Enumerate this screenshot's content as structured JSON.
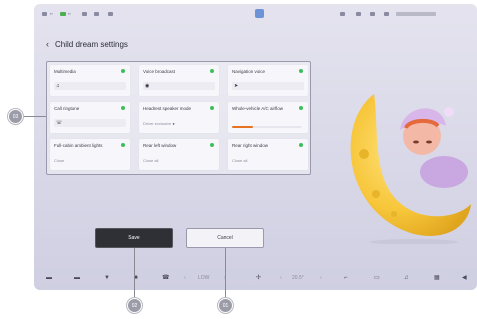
{
  "page": {
    "title": "Child dream settings"
  },
  "tiles": [
    {
      "label": "Multimedia",
      "icon": "music-note-icon",
      "kind": "field",
      "enabled": true
    },
    {
      "label": "Voice broadcast",
      "icon": "speaker-icon",
      "kind": "field",
      "enabled": true
    },
    {
      "label": "Navigation voice",
      "icon": "navigation-arrow-icon",
      "kind": "field",
      "enabled": true
    },
    {
      "label": "Call ringtone",
      "icon": "phone-icon",
      "kind": "field",
      "enabled": true
    },
    {
      "label": "Headrest speaker mode",
      "sub": "Driver exclusive",
      "sub_icon": "info-icon",
      "kind": "sub",
      "enabled": true
    },
    {
      "label": "Whole-vehicle A/C airflow",
      "kind": "slider",
      "level": 0.3,
      "enabled": true
    },
    {
      "label": "Full-cabin ambient lights",
      "sub": "Close",
      "kind": "sub",
      "enabled": true
    },
    {
      "label": "Rear left window",
      "sub": "Close all",
      "kind": "sub",
      "enabled": true
    },
    {
      "label": "Rear right window",
      "sub": "Close all",
      "kind": "sub",
      "enabled": true
    }
  ],
  "buttons": {
    "save": "Save",
    "cancel": "Cancel"
  },
  "dock": {
    "fan_level": "LOW",
    "temperature": "20.5°"
  },
  "callouts": [
    "01",
    "02",
    "03"
  ],
  "colors": {
    "accent_green": "#3cbf5a",
    "airflow_orange": "#e8731f",
    "save_button": "#2f2f36"
  }
}
